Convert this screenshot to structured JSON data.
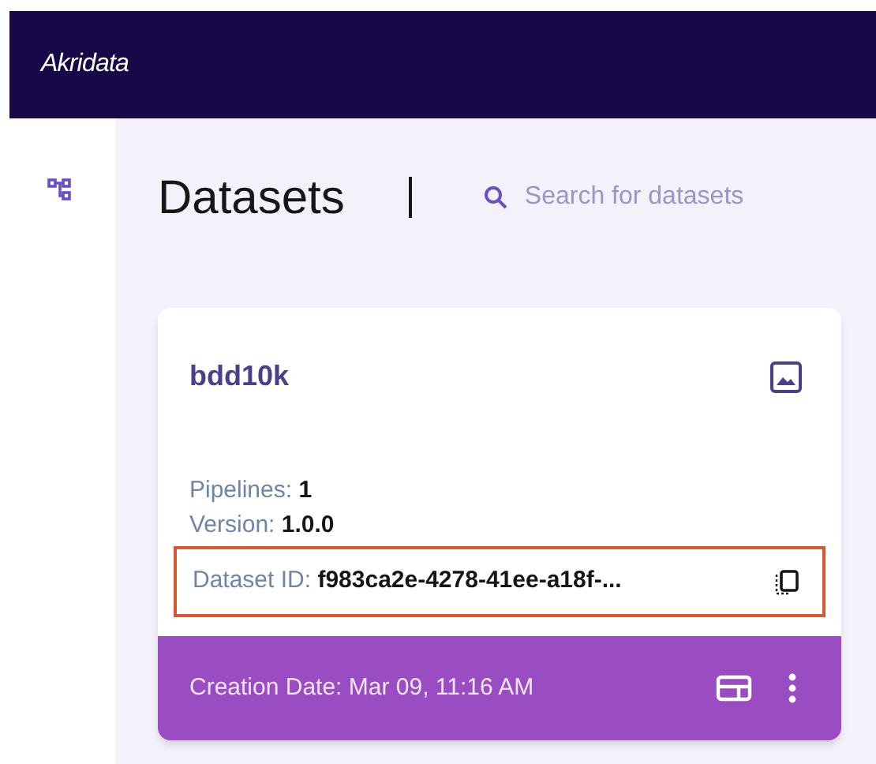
{
  "header": {
    "logo": "Akridata"
  },
  "page": {
    "title": "Datasets",
    "search": {
      "placeholder": "Search for datasets"
    }
  },
  "card": {
    "name": "bdd10k",
    "fields": [
      {
        "label": "Pipelines:",
        "value": "1",
        "highlighted": false
      },
      {
        "label": "Version:",
        "value": "1.0.0",
        "highlighted": false
      },
      {
        "label": "Dataset ID:",
        "value": "f983ca2e-4278-41ee-a18f-...",
        "highlighted": true
      }
    ],
    "footer": "Creation Date: Mar 09, 11:16 AM"
  }
}
